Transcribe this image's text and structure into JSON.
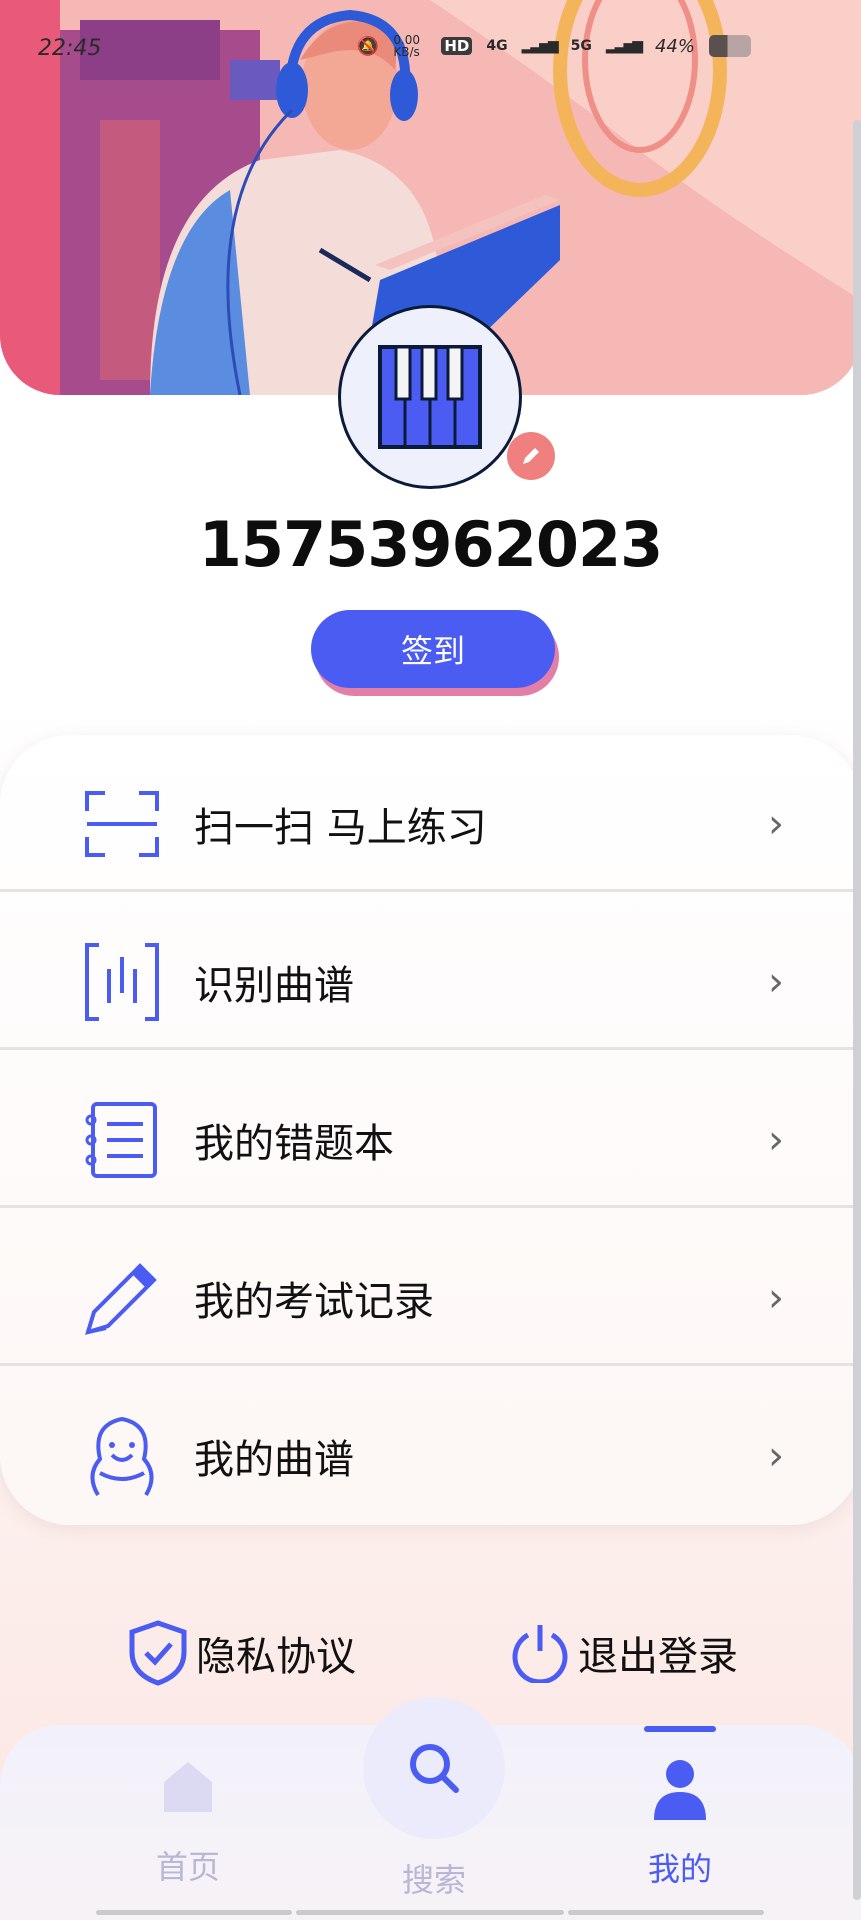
{
  "status_bar": {
    "time": "22:45",
    "net_speed": "0.00 KB/s",
    "hd_label": "HD",
    "network_4g": "4G",
    "network_5g": "5G",
    "battery": "44%"
  },
  "profile": {
    "username": "15753962023",
    "signin_label": "签到",
    "avatar_icon": "piano-keys-icon",
    "edit_icon": "pencil-icon"
  },
  "menu": {
    "items": [
      {
        "label": "扫一扫 马上练习",
        "icon": "scan-icon"
      },
      {
        "label": "识别曲谱",
        "icon": "recognize-icon"
      },
      {
        "label": "我的错题本",
        "icon": "notebook-icon"
      },
      {
        "label": "我的考试记录",
        "icon": "pencil-icon"
      },
      {
        "label": "我的曲谱",
        "icon": "mascot-icon"
      }
    ],
    "chevron": "›"
  },
  "footer": {
    "privacy_label": "隐私协议",
    "logout_label": "退出登录"
  },
  "nav": {
    "home_label": "首页",
    "search_label": "搜索",
    "mine_label": "我的"
  },
  "colors": {
    "accent": "#4a5cf2",
    "inactive": "#b9b6d6",
    "pink": "#f08080"
  }
}
